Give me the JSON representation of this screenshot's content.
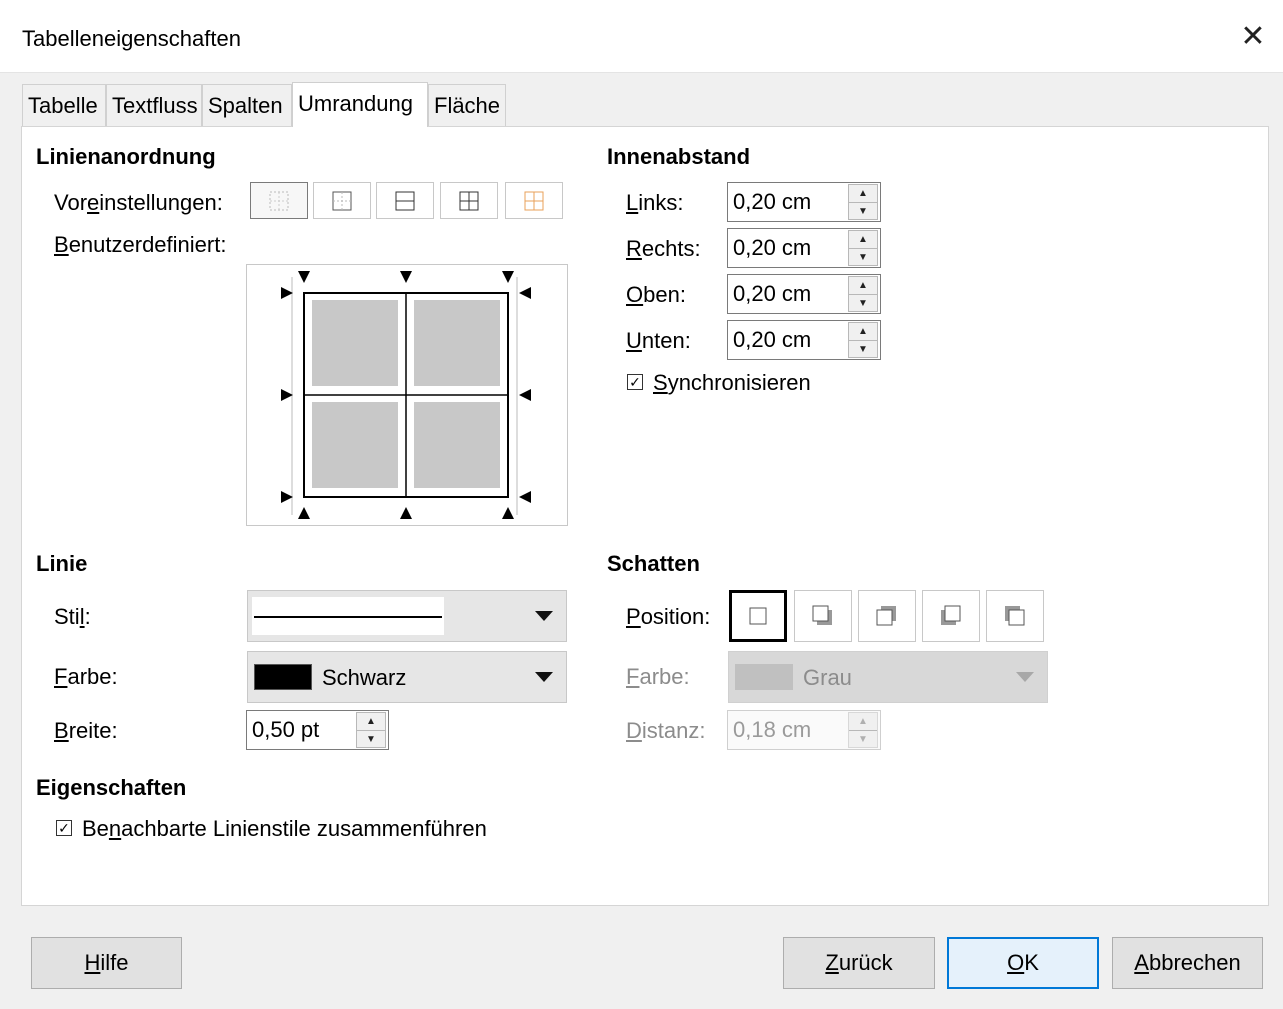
{
  "window": {
    "title": "Tabelleneigenschaften",
    "close_glyph": "✕"
  },
  "tabs": [
    {
      "label": "Tabelle"
    },
    {
      "label": "Textfluss"
    },
    {
      "label": "Spalten"
    },
    {
      "label": "Umrandung",
      "active": true
    },
    {
      "label": "Fläche"
    }
  ],
  "line_arrangement": {
    "heading": "Linienanordnung",
    "presets_label": {
      "pre": "Vor",
      "key": "e",
      "post": "instellungen:"
    },
    "custom_label": {
      "key": "B",
      "post": "enutzerdefiniert:"
    }
  },
  "padding": {
    "heading": "Innenabstand",
    "fields": [
      {
        "key": "L",
        "rest": "inks:",
        "value": "0,20 cm"
      },
      {
        "key": "R",
        "rest": "echts:",
        "value": "0,20 cm"
      },
      {
        "key": "O",
        "rest": "ben:",
        "value": "0,20 cm"
      },
      {
        "key": "U",
        "rest": "nten:",
        "value": "0,20 cm"
      }
    ],
    "sync": {
      "key": "S",
      "rest": "ynchronisieren",
      "checked": true
    }
  },
  "line": {
    "heading": "Linie",
    "style_label": {
      "pre": "Sti",
      "key": "l",
      "post": ":"
    },
    "color_label": {
      "key": "F",
      "post": "arbe:"
    },
    "color_value": "Schwarz",
    "color_swatch": "#000000",
    "width_label": {
      "key": "B",
      "post": "reite:"
    },
    "width_value": "0,50 pt"
  },
  "shadow": {
    "heading": "Schatten",
    "position_label": {
      "key": "P",
      "post": "osition:"
    },
    "color_label": {
      "key": "F",
      "post": "arbe:"
    },
    "color_value": "Grau",
    "color_swatch": "#c0c0c0",
    "distance_label": {
      "key": "D",
      "post": "istanz:"
    },
    "distance_value": "0,18 cm"
  },
  "properties": {
    "heading": "Eigenschaften",
    "merge": {
      "pre": "Be",
      "key": "n",
      "post": "achbarte Linienstile zusammenführen",
      "checked": true
    }
  },
  "buttons": {
    "help": {
      "key": "H",
      "post": "ilfe"
    },
    "back": {
      "key": "Z",
      "post": "urück"
    },
    "ok": {
      "key": "O",
      "post": "K"
    },
    "cancel": {
      "key": "A",
      "post": "bbrechen"
    }
  },
  "colors": {
    "accent": "#0078d7",
    "cell_gray": "#c8c8c8",
    "preset_orange": "#e8a05a"
  }
}
